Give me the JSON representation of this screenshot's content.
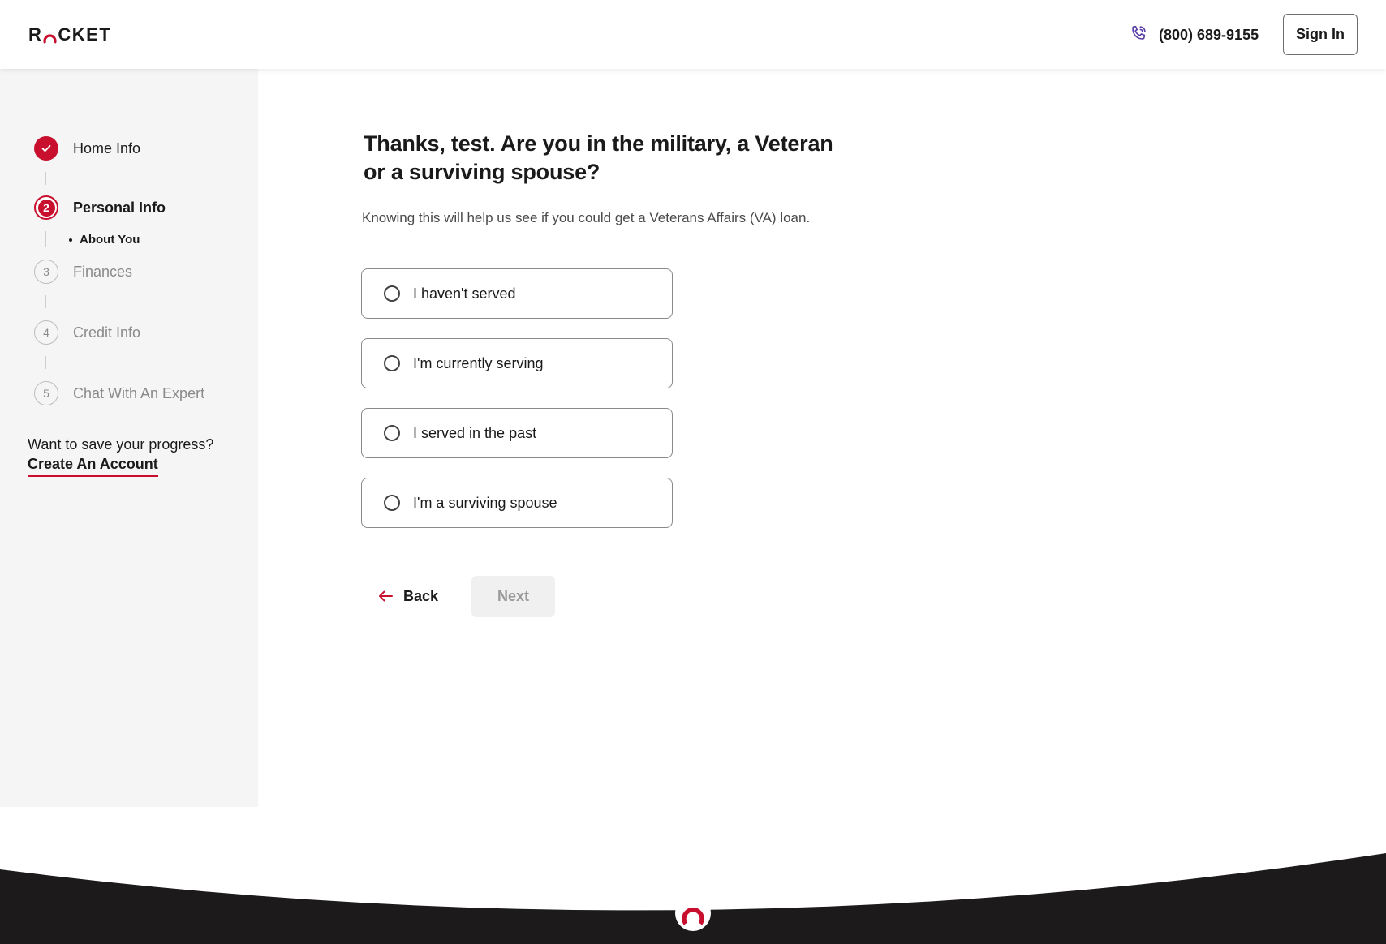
{
  "header": {
    "brand": "ROCKET",
    "phone": "(800) 689-9155",
    "sign_in": "Sign In"
  },
  "sidebar": {
    "steps": [
      {
        "number": "",
        "label": "Home Info",
        "state": "done"
      },
      {
        "number": "2",
        "label": "Personal Info",
        "state": "current"
      },
      {
        "number": "3",
        "label": "Finances",
        "state": "upcoming"
      },
      {
        "number": "4",
        "label": "Credit Info",
        "state": "upcoming"
      },
      {
        "number": "5",
        "label": "Chat With An Expert",
        "state": "upcoming"
      }
    ],
    "substep": "About You",
    "save_prompt": "Want to save your progress?",
    "create_account": "Create An Account"
  },
  "main": {
    "question": "Thanks, test. Are you in the military, a Veteran or a surviving spouse?",
    "subtext": "Knowing this will help us see if you could get a Veterans Affairs (VA) loan.",
    "options": [
      {
        "label": "I haven't served",
        "selected": false
      },
      {
        "label": "I'm currently serving",
        "selected": false
      },
      {
        "label": "I served in the past",
        "selected": false
      },
      {
        "label": "I'm a surviving spouse",
        "selected": false
      }
    ],
    "back": "Back",
    "next": "Next"
  },
  "colors": {
    "brand_red": "#c8102e",
    "footer_dark": "#1c1a1a",
    "sidebar_bg": "#f5f5f5",
    "phone_icon": "#5b3fa8"
  },
  "icons": {
    "phone": "phone-icon",
    "check": "check-icon",
    "back_arrow": "arrow-left-icon",
    "footer_logo": "rocket-logo-icon"
  }
}
